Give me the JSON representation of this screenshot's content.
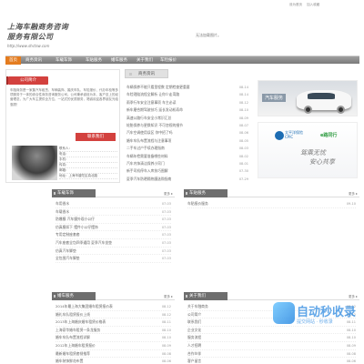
{
  "top_links": [
    "设为首页",
    "加入收藏"
  ],
  "logo": {
    "line1": "上海车融商务咨询",
    "line2": "服务有限公司",
    "url": "http://www.shctsw.com"
  },
  "no_image_text": "无法加载图片。",
  "nav": {
    "items": [
      "首页",
      "商务资讯",
      "车载车饰",
      "车贴服务",
      "婚车服务",
      "关于我们",
      "车险报价"
    ]
  },
  "intro": {
    "tab_label": "公司简介",
    "text": "车融商务是一家集汽车租赁、车辆装饰、婚庆车队、车险报价、代办年检等多项服务于一体的综合性商务咨询服务公司。公司秉承诚信为本、客户至上的经营理念，为广大车主提供全方位、一站式的优质服务，竭诚欢迎各界朋友光临惠顾！"
  },
  "contact": {
    "tab_label": "联系我们",
    "fields": [
      "联系人：",
      "电话：",
      "手机：",
      "传真：",
      "邮箱：",
      "地址：上海市普陀区真北路"
    ]
  },
  "news": {
    "tab_label": "商务资讯",
    "rows": [
      {
        "title": "车辆保养不能只看里程数 定期检查更重要",
        "date": "08-14"
      },
      {
        "title": "车险理赔流程全解析 让你少走弯路",
        "date": "08-14"
      },
      {
        "title": "雨季行车安全注意事项 车主必读",
        "date": "08-12"
      },
      {
        "title": "新车磨合期驾驶技巧 延长发动机寿命",
        "date": "08-10"
      },
      {
        "title": "高速公路行车安全小常识汇总",
        "date": "08-09"
      },
      {
        "title": "轮胎保养与更换知识 不可忽视的细节",
        "date": "08-07"
      },
      {
        "title": "汽车空调使用误区 你中招了吗",
        "date": "08-06"
      },
      {
        "title": "婚车车队布置流程与注意事项",
        "date": "08-05"
      },
      {
        "title": "二手车过户手续办理指南",
        "date": "08-03"
      },
      {
        "title": "车辆年检需要准备哪些材料",
        "date": "08-02"
      },
      {
        "title": "汽车内饰清洁保养小窍门",
        "date": "08-01"
      },
      {
        "title": "新手司机停车入库技巧图解",
        "date": "07-30"
      },
      {
        "title": "夏季汽车防晒隔热膜选购指南",
        "date": "07-29"
      }
    ]
  },
  "banners": {
    "car_caption": "汽车服务",
    "insurer_name": "太平洋保险",
    "insurer_sub": "CPIC",
    "insurer2": "e路同行",
    "slogan_line1": "驾乘无忧",
    "slogan_line2": "安心共享"
  },
  "panels": [
    {
      "title": "车载车饰",
      "more": "更多",
      "rows": [
        {
          "title": "车用香水",
          "date": "07-03"
        },
        {
          "title": "车载香水",
          "date": "07-03"
        },
        {
          "title": "防爆膜 汽车膜外观小公仔",
          "date": "07-03"
        },
        {
          "title": "仿真膜如下 摆件小公仔摆饰",
          "date": "07-03"
        },
        {
          "title": "专用定制座套套",
          "date": "07-03"
        },
        {
          "title": "汽车座套全包四季通用 夏季汽车坐垫",
          "date": "07-03"
        },
        {
          "title": "仿真汽车脚垫",
          "date": "07-03"
        },
        {
          "title": "全包围汽车脚垫",
          "date": "07-03"
        }
      ]
    },
    {
      "title": "车贴服务",
      "more": "更多",
      "rows": [
        {
          "title": "车贴报价服务",
          "date": "09-10"
        }
      ]
    },
    {
      "title": "婚车服务",
      "more": "更多",
      "rows": [
        {
          "title": "2014年最上海大集团婚车租赁报价表",
          "date": "08-12"
        },
        {
          "title": "婚礼车队租赁报价上线",
          "date": "08-12"
        },
        {
          "title": "2013年上海婚庆婚车租赁价格表",
          "date": "08-11"
        },
        {
          "title": "上海豪华婚车租赁一条龙服务",
          "date": "08-10"
        },
        {
          "title": "婚车车队布置流程详解",
          "date": "08-10"
        },
        {
          "title": "2012年上海婚车租赁报价",
          "date": "08-09"
        },
        {
          "title": "最新婚车租赁套餐推荐",
          "date": "08-08"
        },
        {
          "title": "婚车装饰鲜花布置",
          "date": "08-06"
        }
      ]
    },
    {
      "title": "关于我们",
      "more": "更多",
      "rows": [
        {
          "title": "关于车融商务",
          "date": "08-12"
        },
        {
          "title": "公司简介",
          "date": "08-12"
        },
        {
          "title": "联系我们",
          "date": "08-11"
        },
        {
          "title": "企业文化",
          "date": "08-10"
        },
        {
          "title": "服务流程",
          "date": "08-10"
        },
        {
          "title": "人才招聘",
          "date": "08-09"
        },
        {
          "title": "合作伙伴",
          "date": "08-08"
        },
        {
          "title": "客户留言",
          "date": "08-06"
        }
      ]
    }
  ],
  "watermark": {
    "big": "自动秒收录",
    "small": "提交网站 · 秒收录"
  }
}
